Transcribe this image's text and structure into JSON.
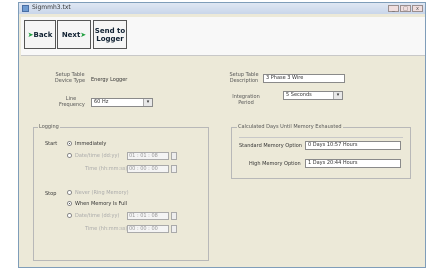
{
  "window": {
    "title": "Sigmmh3.txt",
    "minimize": "_",
    "maximize": "□",
    "close": "x"
  },
  "toolbar": {
    "back_label": "Back",
    "next_label": "Next",
    "send_label_line1": "Send to",
    "send_label_line2": "Logger"
  },
  "setup": {
    "device_type_label_line1": "Setup Table",
    "device_type_label_line2": "Device Type",
    "device_type_value": "Energy Logger",
    "line_freq_label_line1": "Line",
    "line_freq_label_line2": "Frequency",
    "line_freq_value": "60 Hz",
    "desc_label_line1": "Setup Table",
    "desc_label_line2": "Description",
    "desc_value": "3 Phase 3 Wire",
    "integration_label_line1": "Integration",
    "integration_label_line2": "Period",
    "integration_value": "5 Seconds"
  },
  "logging": {
    "title": "Logging",
    "start_label": "Start",
    "start_immediately": "Immediately",
    "start_datetime": "Date/time (dd:yy)",
    "start_time": "Time (hh:mm:ss)",
    "start_date_value": "01 : 01 : 08",
    "start_time_value": "00 : 00 : 00",
    "stop_label": "Stop",
    "stop_never": "Never (Ring Memory)",
    "stop_when_full": "When Memory Is Full",
    "stop_datetime": "Date/time (dd:yy)",
    "stop_time": "Time (hh:mm:ss)",
    "stop_date_value": "01 : 01 : 08",
    "stop_time_value": "00 : 00 : 00"
  },
  "memory": {
    "title": "Calculated Days Until Memory Exhausted",
    "standard_label": "Standard Memory Option",
    "standard_value": "0 Days 10:57 Hours",
    "high_label": "High Memory Option",
    "high_value": "1 Days 20:44 Hours"
  }
}
